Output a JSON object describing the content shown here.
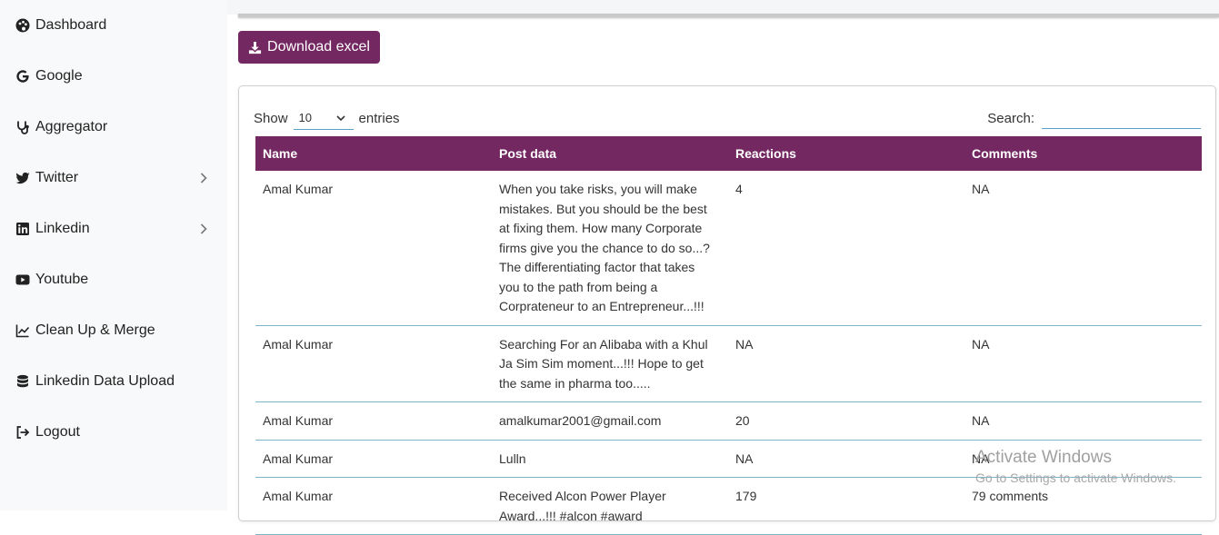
{
  "sidebar": {
    "items": [
      {
        "label": "Dashboard",
        "icon": "palette-icon"
      },
      {
        "label": "Google",
        "icon": "google-icon"
      },
      {
        "label": "Aggregator",
        "icon": "stethoscope-icon"
      },
      {
        "label": "Twitter",
        "icon": "twitter-icon"
      },
      {
        "label": "Linkedin",
        "icon": "linkedin-icon"
      },
      {
        "label": "Youtube",
        "icon": "youtube-icon"
      },
      {
        "label": "Clean Up & Merge",
        "icon": "line-chart-icon"
      },
      {
        "label": "Linkedin Data Upload",
        "icon": "database-icon"
      },
      {
        "label": "Logout",
        "icon": "logout-icon"
      }
    ]
  },
  "toolbar": {
    "download_label": "Download excel"
  },
  "table_controls": {
    "show_label": "Show",
    "page_length": "10",
    "entries_label": "entries",
    "search_label": "Search:",
    "search_value": ""
  },
  "table": {
    "headers": [
      "Name",
      "Post data",
      "Reactions",
      "Comments"
    ],
    "rows": [
      {
        "name": "Amal Kumar",
        "post": "When you take risks, you will make mistakes. But you should be the best at fixing them. How many Corporate firms give you the chance to do so...? The differentiating factor that takes you to the path from being a Corprateneur to an Entrepreneur...!!!",
        "reactions": "4",
        "comments": "NA"
      },
      {
        "name": "Amal Kumar",
        "post": "Searching For an Alibaba with a Khul Ja Sim Sim moment...!!! Hope to get the same in pharma too.....",
        "reactions": "NA",
        "comments": "NA"
      },
      {
        "name": "Amal Kumar",
        "post": "amalkumar2001@gmail.com",
        "reactions": "20",
        "comments": "NA"
      },
      {
        "name": "Amal Kumar",
        "post": "Lulln",
        "reactions": "NA",
        "comments": "NA"
      },
      {
        "name": "Amal Kumar",
        "post": "Received Alcon Power Player Award...!!! #alcon #award",
        "reactions": "179",
        "comments": "79 comments"
      }
    ]
  },
  "watermark": {
    "title": "Activate Windows",
    "subtitle": "Go to Settings to activate Windows."
  },
  "colors": {
    "accent": "#742862",
    "sidebar_bg": "#f8f9fa",
    "row_border": "#7fb3c9"
  }
}
